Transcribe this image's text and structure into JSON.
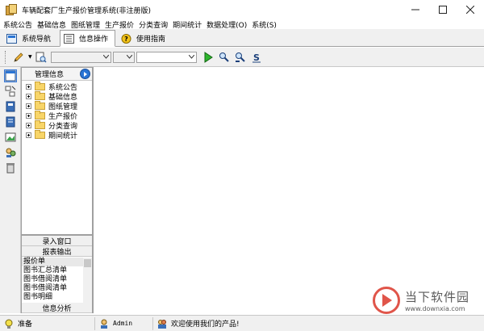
{
  "window": {
    "title": "车辆配套厂生产报价管理系统(非注册版)"
  },
  "menu": [
    "系统公告",
    "基础信息",
    "图纸管理",
    "生产报价",
    "分类查询",
    "期间统计",
    "数据处理(O)",
    "系统(S)"
  ],
  "tabs": [
    {
      "label": "系统导航",
      "icon": "navigation-icon"
    },
    {
      "label": "信息操作",
      "icon": "info-operation-icon"
    },
    {
      "label": "使用指南",
      "icon": "help-icon"
    }
  ],
  "tree": {
    "header": "管理信息",
    "nodes": [
      "系统公告",
      "基础信息",
      "图纸管理",
      "生产报价",
      "分类查询",
      "期间统计"
    ]
  },
  "bottom_panel": {
    "buttons": [
      "录入窗口",
      "报表输出"
    ],
    "list": [
      "报价单",
      "图书汇总清单",
      "图书借阅清单",
      "图书借阅清单",
      "图书明细"
    ],
    "footer": "信息分析"
  },
  "status": {
    "ready": "准备",
    "user": "Admin",
    "welcome": "欢迎使用我们的产品!"
  },
  "watermark": {
    "title": "当下软件园",
    "url": "www.downxia.com"
  },
  "colors": {
    "accent_blue": "#2a74d4",
    "folder_yellow": "#f8d568",
    "watermark_red": "#e0554a"
  }
}
